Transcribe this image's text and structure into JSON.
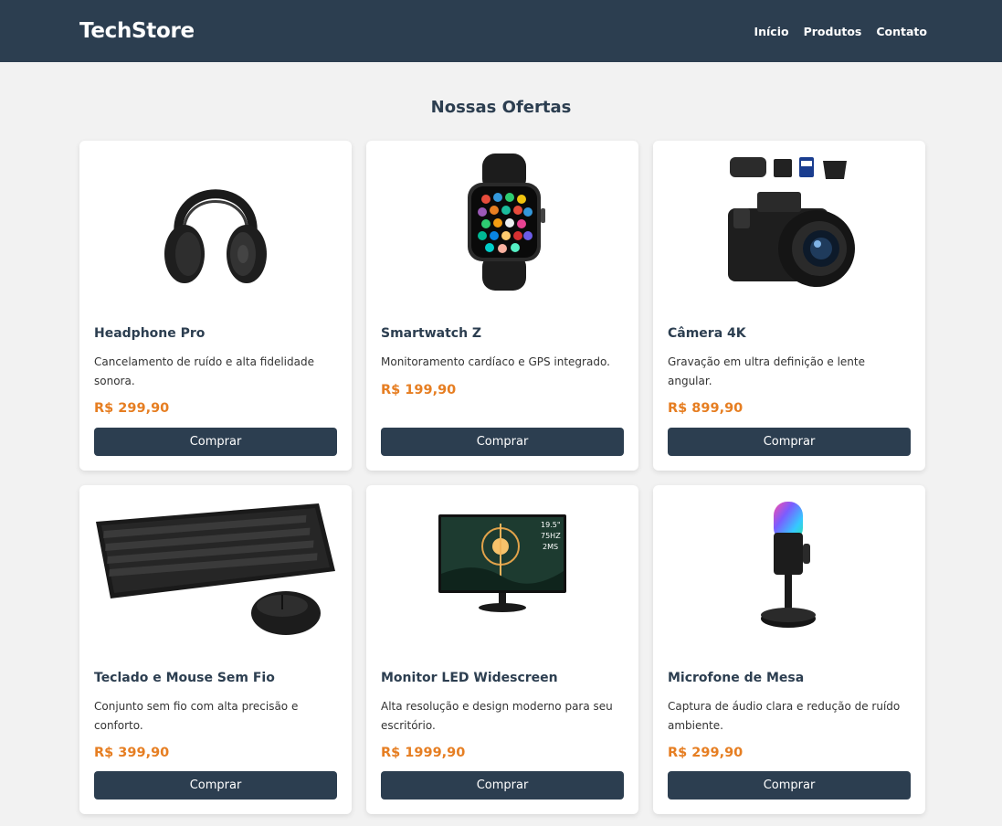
{
  "header": {
    "brand": "TechStore",
    "nav": [
      "Início",
      "Produtos",
      "Contato"
    ]
  },
  "section_title": "Nossas Ofertas",
  "products": [
    {
      "title": "Headphone Pro",
      "description": "Cancelamento de ruído e alta fidelidade sonora.",
      "price": "R$ 299,90",
      "button": "Comprar",
      "icon": "headphone-image"
    },
    {
      "title": "Smartwatch Z",
      "description": "Monitoramento cardíaco e GPS integrado.",
      "price": "R$ 199,90",
      "button": "Comprar",
      "icon": "smartwatch-image"
    },
    {
      "title": "Câmera 4K",
      "description": "Gravação em ultra definição e lente angular.",
      "price": "R$ 899,90",
      "button": "Comprar",
      "icon": "camera-image"
    },
    {
      "title": "Teclado e Mouse Sem Fio",
      "description": "Conjunto sem fio com alta precisão e conforto.",
      "price": "R$ 399,90",
      "button": "Comprar",
      "icon": "keyboard-mouse-image"
    },
    {
      "title": "Monitor LED Widescreen",
      "description": "Alta resolução e design moderno para seu escritório.",
      "price": "R$ 1999,90",
      "button": "Comprar",
      "icon": "monitor-image"
    },
    {
      "title": "Microfone de Mesa",
      "description": "Captura de áudio clara e redução de ruído ambiente.",
      "price": "R$ 299,90",
      "button": "Comprar",
      "icon": "microphone-image"
    }
  ],
  "monitor_specs": [
    "19.5\"",
    "75HZ",
    "2MS"
  ],
  "colors": {
    "header_bg": "#2c3e50",
    "accent_price": "#e67e22",
    "page_bg": "#f2f2f2"
  }
}
